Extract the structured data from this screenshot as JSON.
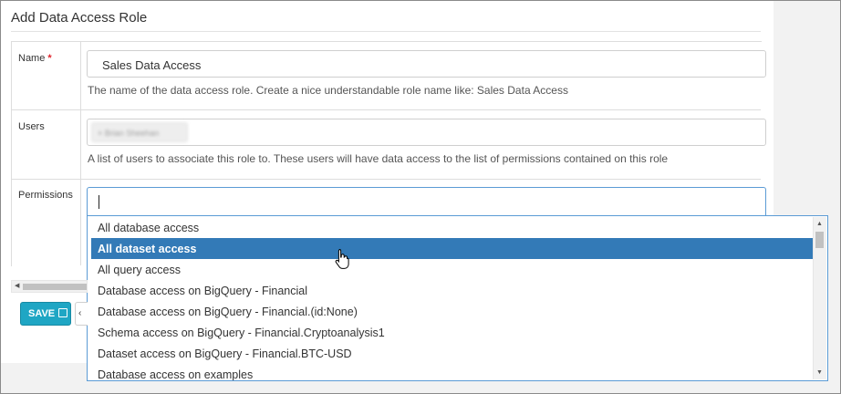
{
  "page": {
    "title": "Add Data Access Role"
  },
  "form": {
    "name": {
      "label": "Name",
      "required_mark": "*",
      "value": "Sales Data Access",
      "help": "The name of the data access role. Create a nice understandable role name like: Sales Data Access"
    },
    "users": {
      "label": "Users",
      "selected_user": "× Brian Sheehan",
      "help": "A list of users to associate this role to. These users will have data access to the list of permissions contained on this role"
    },
    "permissions": {
      "label": "Permissions",
      "options": [
        "All database access",
        "All dataset access",
        "All query access",
        "Database access on BigQuery - Financial",
        "Database access on BigQuery - Financial.(id:None)",
        "Schema access on BigQuery - Financial.Cryptoanalysis1",
        "Dataset access on BigQuery - Financial.BTC-USD",
        "Database access on examples"
      ],
      "highlighted_option": "All dataset access"
    }
  },
  "actions": {
    "save_label": "SAVE",
    "back_label": "‹"
  },
  "icons": {
    "save": "floppy-disk-icon",
    "cursor": "hand-pointer-icon"
  },
  "colors": {
    "accent": "#1fa6c4",
    "highlight": "#337ab7",
    "focus_border": "#5b9bd5",
    "required": "#e0262e"
  }
}
